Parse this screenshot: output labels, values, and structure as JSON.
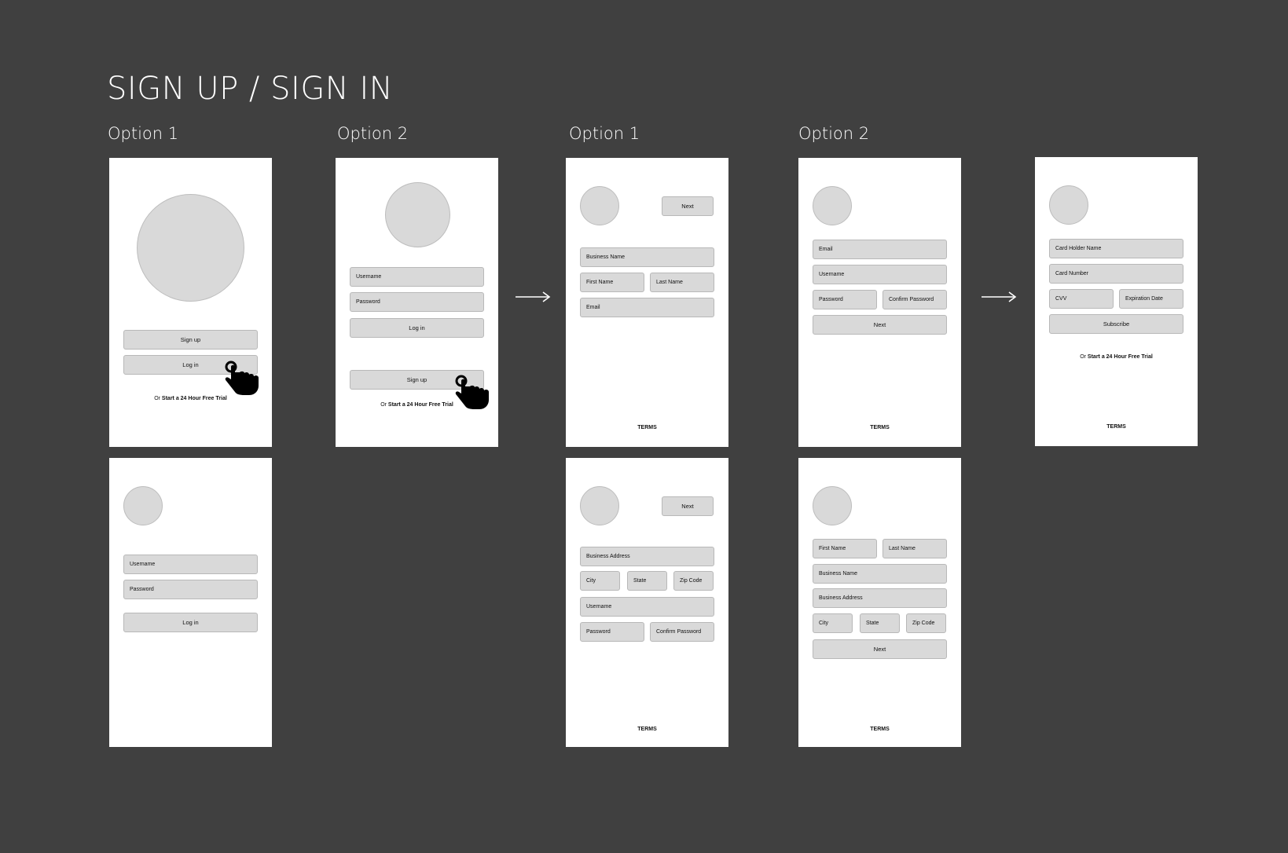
{
  "page_title": "SIGN UP / SIGN IN",
  "option_labels": {
    "a": "Option 1",
    "b": "Option 2",
    "c": "Option 1",
    "d": "Option 2"
  },
  "screen1": {
    "signup": "Sign up",
    "login": "Log in",
    "trial_prefix": "Or ",
    "trial_link": "Start a 24 Hour Free Trial"
  },
  "screen2": {
    "username": "Username",
    "password": "Password",
    "login": "Log in"
  },
  "screen3": {
    "username": "Username",
    "password": "Password",
    "login": "Log in",
    "signup": "Sign up",
    "trial_prefix": "Or ",
    "trial_link": "Start a 24 Hour Free Trial"
  },
  "screen4": {
    "next": "Next",
    "business_name": "Business Name",
    "first_name": "First Name",
    "last_name": "Last Name",
    "email": "Email",
    "terms": "TERMS"
  },
  "screen5": {
    "next": "Next",
    "business_address": "Business Address",
    "city": "City",
    "state": "State",
    "zip": "Zip Code",
    "username": "Username",
    "password": "Password",
    "confirm_password": "Confirm Password",
    "terms": "TERMS"
  },
  "screen6": {
    "email": "Email",
    "username": "Username",
    "password": "Password",
    "confirm_password": "Confirm Password",
    "next": "Next",
    "terms": "TERMS"
  },
  "screen7": {
    "first_name": "First Name",
    "last_name": "Last Name",
    "business_name": "Business Name",
    "business_address": "Business Address",
    "city": "City",
    "state": "State",
    "zip": "Zip Code",
    "next": "Next",
    "terms": "TERMS"
  },
  "screen8": {
    "card_holder": "Card Holder Name",
    "card_number": "Card Number",
    "cvv": "CVV",
    "expiration": "Expiration Date",
    "subscribe": "Subscribe",
    "trial_prefix": "Or ",
    "trial_link": "Start a 24 Hour Free Trial",
    "terms": "TERMS"
  },
  "icons": {
    "arrow": "right-arrow-icon",
    "hand": "hand-pointer-icon"
  },
  "colors": {
    "background": "#404040",
    "screen": "#ffffff",
    "placeholder": "#d9d9d9"
  }
}
